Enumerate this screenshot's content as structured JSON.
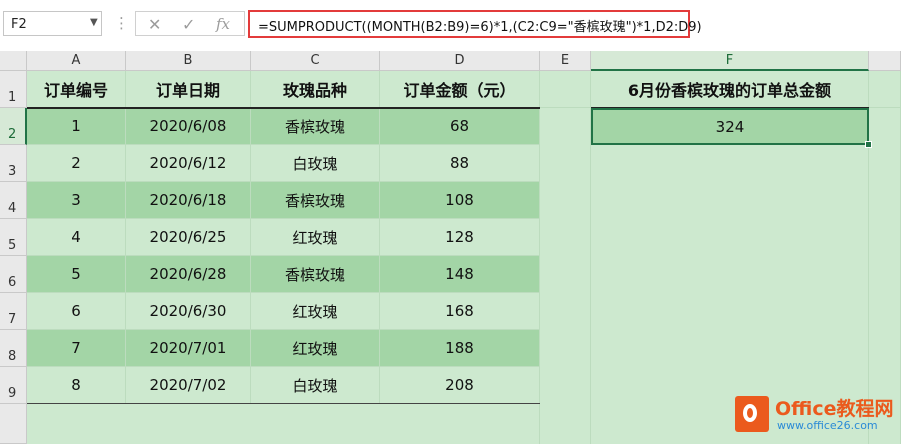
{
  "name_box": "F2",
  "formula_bar": {
    "cancel_icon": "x-icon",
    "enter_icon": "check-icon",
    "function_icon": "fx",
    "formula": "=SUMPRODUCT((MONTH(B2:B9)=6)*1,(C2:C9=\"香槟玫瑰\")*1,D2:D9)"
  },
  "columns": [
    "A",
    "B",
    "C",
    "D",
    "E",
    "F"
  ],
  "rows": [
    "1",
    "2",
    "3",
    "4",
    "5",
    "6",
    "7",
    "8",
    "9"
  ],
  "table": {
    "headers": [
      "订单编号",
      "订单日期",
      "玫瑰品种",
      "订单金额（元）"
    ],
    "rows": [
      [
        "1",
        "2020/6/08",
        "香槟玫瑰",
        "68"
      ],
      [
        "2",
        "2020/6/12",
        "白玫瑰",
        "88"
      ],
      [
        "3",
        "2020/6/18",
        "香槟玫瑰",
        "108"
      ],
      [
        "4",
        "2020/6/25",
        "红玫瑰",
        "128"
      ],
      [
        "5",
        "2020/6/28",
        "香槟玫瑰",
        "148"
      ],
      [
        "6",
        "2020/6/30",
        "红玫瑰",
        "168"
      ],
      [
        "7",
        "2020/7/01",
        "红玫瑰",
        "188"
      ],
      [
        "8",
        "2020/7/02",
        "白玫瑰",
        "208"
      ]
    ]
  },
  "summary": {
    "header": "6月份香槟玫瑰的订单总金额",
    "value": "324"
  },
  "watermark": {
    "brand": "Office教程网",
    "url": "www.office26.com"
  },
  "colors": {
    "band_dark": "#a3d5a6",
    "band_light": "#cde9cf",
    "highlight_border": "#e33b3b",
    "selection": "#217346"
  }
}
